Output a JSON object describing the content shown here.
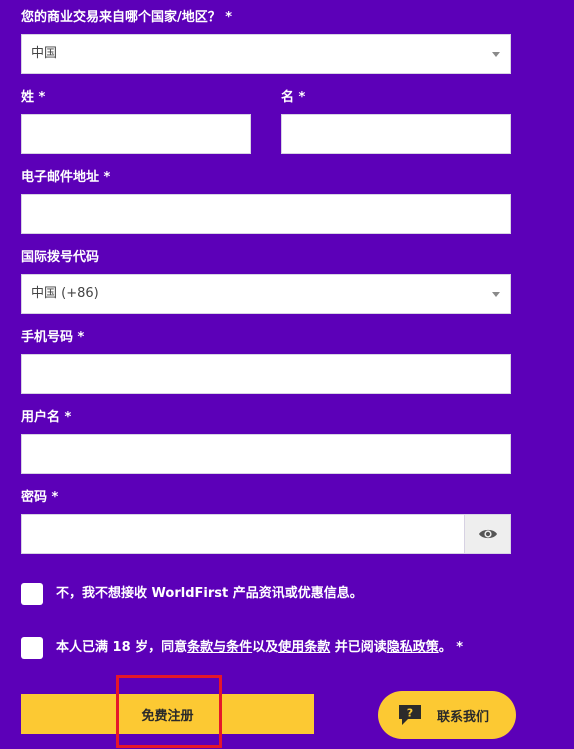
{
  "form": {
    "country_label": "您的商业交易来自哪个国家/地区？ *",
    "country_value": "中国",
    "last_name_label": "姓 *",
    "first_name_label": "名 *",
    "email_label": "电子邮件地址 *",
    "dial_code_label": "国际拨号代码",
    "dial_code_value": "中国 (+86)",
    "mobile_label": "手机号码 *",
    "username_label": "用户名 *",
    "password_label": "密码 *"
  },
  "checkboxes": {
    "marketing_text": "不，我不想接收 WorldFirst 产品资讯或优惠信息。",
    "terms_prefix": "本人已满 18 岁，同意",
    "terms_link": "条款与条件",
    "terms_mid1": "以及",
    "usage_link": "使用条款",
    "terms_mid2": " 并已阅读",
    "privacy_link": "隐私政策",
    "terms_suffix": "。 *"
  },
  "actions": {
    "submit_label": "免费注册",
    "contact_label": "联系我们"
  },
  "icons": {
    "select_caret": "chevron-down-icon",
    "password_toggle": "eye-icon",
    "contact": "chat-question-icon"
  },
  "colors": {
    "background": "#5c00b8",
    "accent": "#fcc933",
    "highlight": "#e5172a"
  }
}
